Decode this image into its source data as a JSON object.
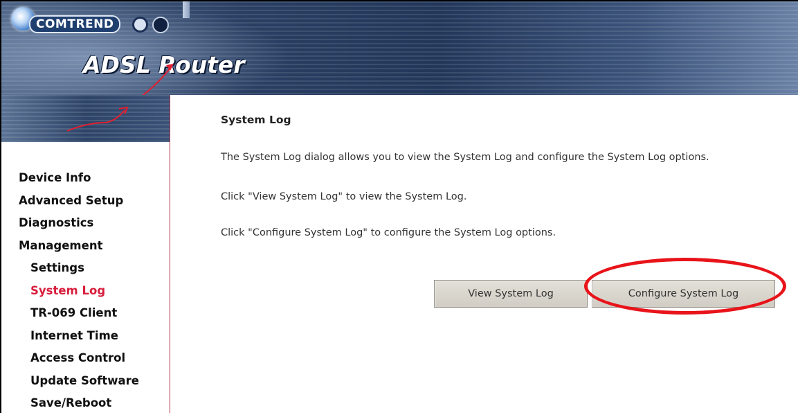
{
  "brand": {
    "logo_text": "COMTREND",
    "product_title": "ADSL Router"
  },
  "sidebar": {
    "items": [
      {
        "label": "Device Info",
        "level": 0,
        "active": false
      },
      {
        "label": "Advanced Setup",
        "level": 0,
        "active": false
      },
      {
        "label": "Diagnostics",
        "level": 0,
        "active": false
      },
      {
        "label": "Management",
        "level": 0,
        "active": false
      },
      {
        "label": "Settings",
        "level": 1,
        "active": false
      },
      {
        "label": "System Log",
        "level": 1,
        "active": true
      },
      {
        "label": "TR-069 Client",
        "level": 1,
        "active": false
      },
      {
        "label": "Internet Time",
        "level": 1,
        "active": false
      },
      {
        "label": "Access Control",
        "level": 1,
        "active": false
      },
      {
        "label": "Update Software",
        "level": 1,
        "active": false
      },
      {
        "label": "Save/Reboot",
        "level": 1,
        "active": false
      }
    ]
  },
  "main": {
    "title": "System Log",
    "paragraphs": [
      "The System Log dialog allows you to view the System Log and configure the System Log options.",
      "Click \"View System Log\" to view the System Log.",
      "Click \"Configure System Log\" to configure the System Log options."
    ],
    "buttons": {
      "view": "View System Log",
      "configure": "Configure System Log"
    }
  },
  "colors": {
    "active_nav": "#d81e3c",
    "highlight": "#e8141a",
    "banner": "#2a3f63"
  }
}
